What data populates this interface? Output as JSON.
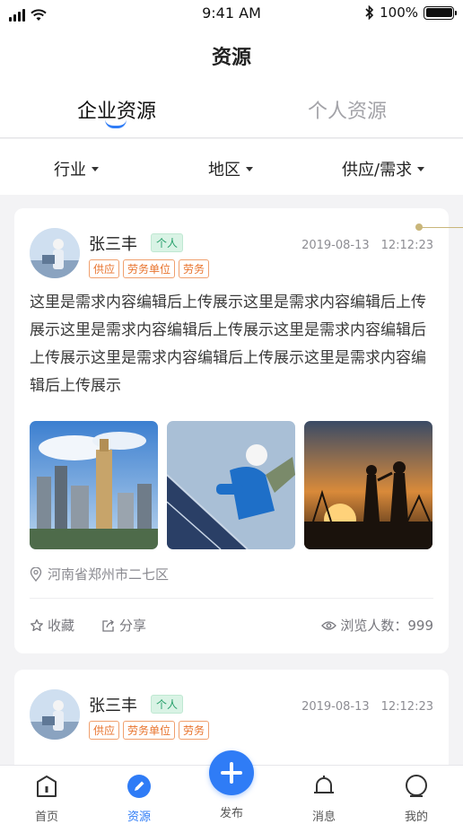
{
  "status": {
    "time": "9:41 AM",
    "battery": "100%"
  },
  "nav": {
    "title": "资源"
  },
  "tabs": [
    {
      "label": "企业资源"
    },
    {
      "label": "个人资源"
    }
  ],
  "filters": [
    {
      "label": "行业"
    },
    {
      "label": "地区"
    },
    {
      "label": "供应/需求"
    }
  ],
  "cards": [
    {
      "user": "张三丰",
      "badge": "个人",
      "tags": [
        "供应",
        "劳务单位",
        "劳务"
      ],
      "date": "2019-08-13　12:12:23",
      "content": "这里是需求内容编辑后上传展示这里是需求内容编辑后上传展示这里是需求内容编辑后上传展示这里是需求内容编辑后上传展示这里是需求内容编辑后上传展示这里是需求内容编辑后上传展示",
      "location": "河南省郑州市二七区",
      "favorite": "收藏",
      "share": "分享",
      "views": "浏览人数：999"
    },
    {
      "user": "张三丰",
      "badge": "个人",
      "tags": [
        "供应",
        "劳务单位",
        "劳务"
      ],
      "date": "2019-08-13　12:12:23"
    }
  ],
  "tabbar": [
    {
      "label": "首页",
      "icon": "home-icon"
    },
    {
      "label": "资源",
      "icon": "resource-icon"
    },
    {
      "label": "发布",
      "icon": "plus-icon"
    },
    {
      "label": "消息",
      "icon": "bell-icon"
    },
    {
      "label": "我的",
      "icon": "profile-icon"
    }
  ],
  "colors": {
    "accent": "#2f7cf6",
    "tag": "#e8732c",
    "badge": "#27a06b"
  }
}
